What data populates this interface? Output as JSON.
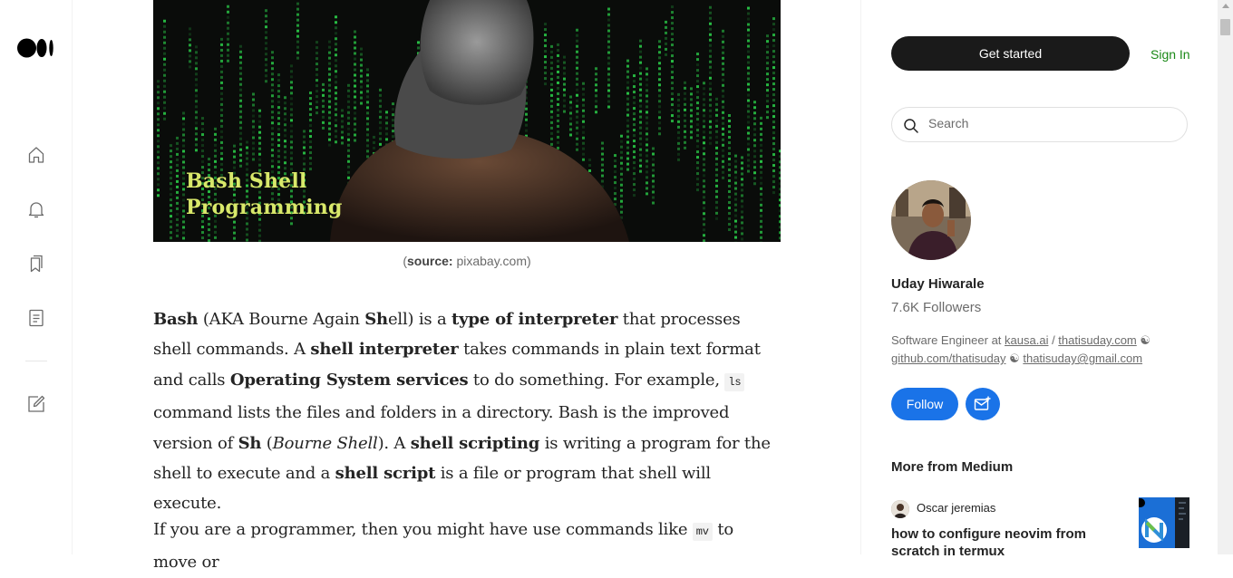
{
  "rail": {
    "logo": "medium-logo",
    "icons": [
      "home-icon",
      "notifications-bell-icon",
      "bookmarks-icon",
      "stories-icon",
      "write-icon"
    ]
  },
  "article": {
    "hero": {
      "title_line1": "Bash Shell",
      "title_line2": "Programming"
    },
    "caption": {
      "open": "(",
      "source_label": "source:",
      "source_value": " pixabay.com)"
    },
    "para1": [
      {
        "t": "Bash",
        "b": true
      },
      {
        "t": " (AKA Bourne Again "
      },
      {
        "t": "Sh",
        "b": true
      },
      {
        "t": "ell) is a "
      },
      {
        "t": "type of interpreter",
        "b": true
      },
      {
        "t": " that processes shell commands. A "
      },
      {
        "t": "shell interpreter",
        "b": true
      },
      {
        "t": " takes commands in plain text format and calls "
      },
      {
        "t": "Operating System services",
        "b": true
      },
      {
        "t": " to do something. For example, "
      },
      {
        "t": "ls",
        "c": true
      },
      {
        "t": " command lists the files and folders in a directory. Bash is the improved version of "
      },
      {
        "t": "Sh",
        "b": true
      },
      {
        "t": " ("
      },
      {
        "t": "Bourne Shell",
        "i": true
      },
      {
        "t": "). A "
      },
      {
        "t": "shell scripting",
        "b": true
      },
      {
        "t": " is writing a program for the shell to execute and a "
      },
      {
        "t": "shell script",
        "b": true
      },
      {
        "t": " is a file or program that shell will execute."
      }
    ],
    "para2": [
      {
        "t": "If you are a programmer, then you might have use commands like "
      },
      {
        "t": "mv",
        "c": true
      },
      {
        "t": " to move or"
      }
    ]
  },
  "sidebar": {
    "get_started": "Get started",
    "sign_in": "Sign In",
    "search_placeholder": "Search",
    "author": {
      "name": "Uday Hiwarale",
      "followers": "7.6K Followers",
      "bio_prefix": "Software Engineer at ",
      "bio_link1": "kausa.ai",
      "bio_sep1": " / ",
      "bio_link2": "thatisuday.com",
      "bio_sep2": " ☯ ",
      "bio_link3": "github.com/thatisuday",
      "bio_sep3": " ☯ ",
      "bio_link4": "thatisuday@gmail.com"
    },
    "follow": "Follow",
    "more_heading": "More from Medium",
    "recommendation": {
      "author": "Oscar jeremias",
      "title": "how to configure neovim from scratch in termux"
    }
  },
  "colors": {
    "accent_blue": "#1a73e8",
    "signin_green": "#1a8917",
    "dark_button": "#1a1a1a",
    "hero_text": "#d8e86a",
    "matrix_green": "#2bd14a"
  }
}
